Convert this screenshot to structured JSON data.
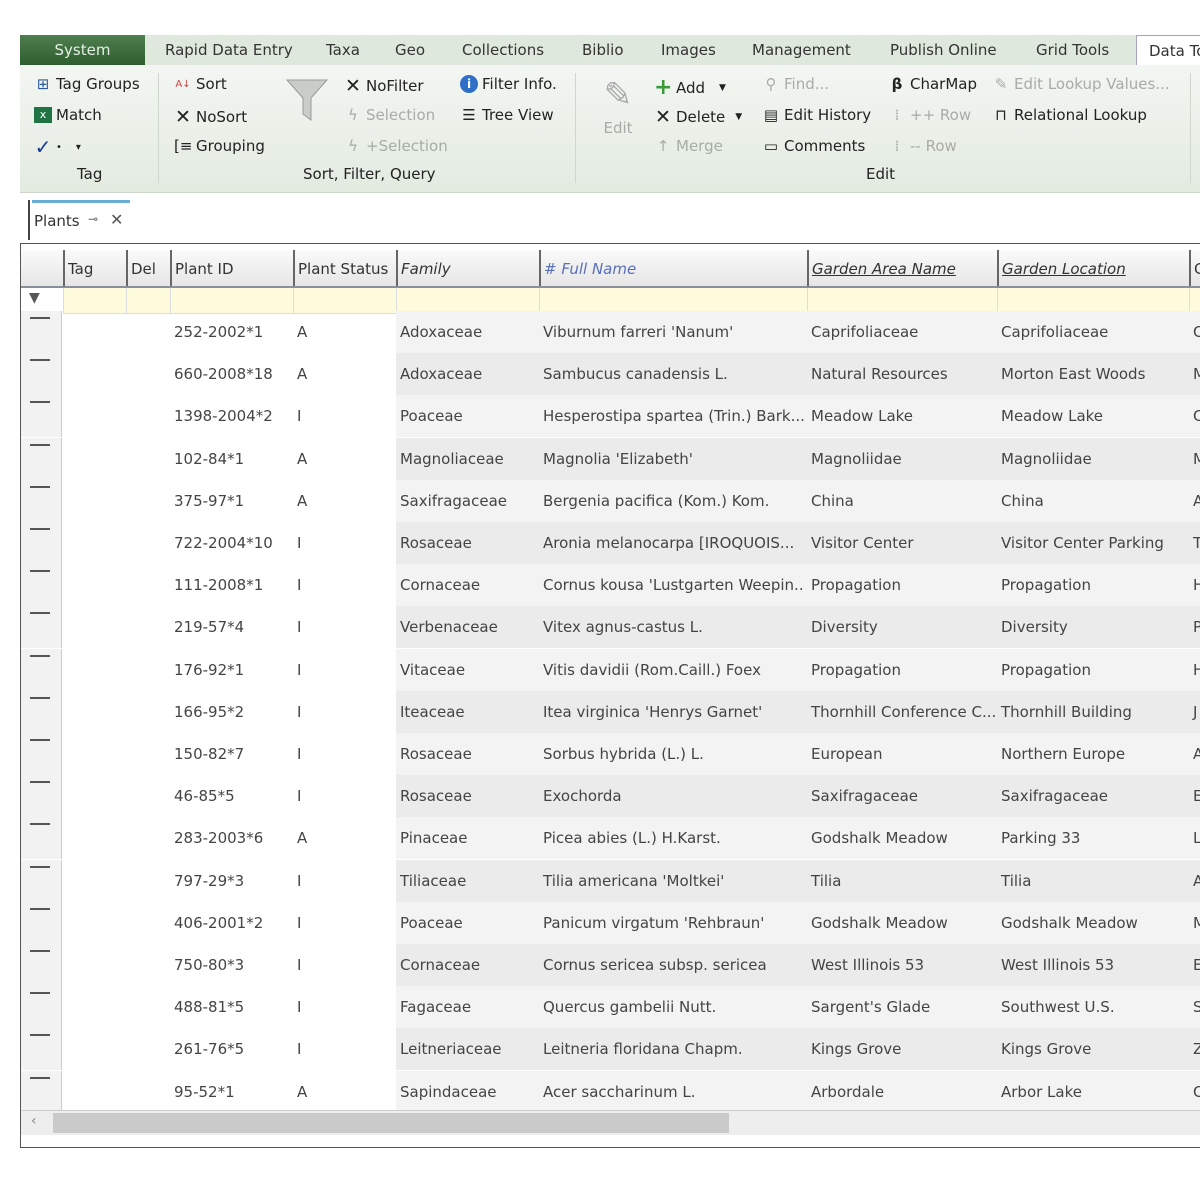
{
  "tabs": [
    "System",
    "Rapid Data Entry",
    "Taxa",
    "Geo",
    "Collections",
    "Biblio",
    "Images",
    "Management",
    "Publish Online",
    "Grid Tools",
    "Data To"
  ],
  "ribbon": {
    "tag": {
      "tag_groups": "Tag Groups",
      "match": "Match",
      "check_dropdown": "▾",
      "group_label": "Tag"
    },
    "sort_filter": {
      "sort": "Sort",
      "nosort": "NoSort",
      "grouping": "Grouping",
      "nofilter": "NoFilter",
      "selection": "Selection",
      "plus_selection": "+Selection",
      "filter_info": "Filter Info.",
      "tree_view": "Tree View",
      "group_label": "Sort, Filter, Query"
    },
    "edit": {
      "edit": "Edit",
      "add": "Add",
      "delete": "Delete",
      "merge": "Merge",
      "find": "Find...",
      "edit_history": "Edit History",
      "comments": "Comments",
      "charmap": "CharMap",
      "add_row": "++ Row",
      "remove_row": "-- Row",
      "edit_lookup": "Edit Lookup Values...",
      "relational_lookup": "Relational Lookup",
      "group_label": "Edit"
    }
  },
  "doc_tab": {
    "label": "Plants"
  },
  "grid": {
    "columns": [
      "Tag",
      "Del",
      "Plant ID",
      "Plant Status",
      "Family",
      "# Full Name",
      "Garden Area Name",
      "Garden Location",
      "G"
    ],
    "rows": [
      [
        "252-2002*1",
        "A",
        "Adoxaceae",
        "Viburnum farreri 'Nanum'",
        "Caprifoliaceae",
        "Caprifoliaceae",
        "C"
      ],
      [
        "660-2008*18",
        "A",
        "Adoxaceae",
        "Sambucus canadensis L.",
        "Natural Resources",
        "Morton East Woods",
        "M"
      ],
      [
        "1398-2004*2",
        "I",
        "Poaceae",
        "Hesperostipa spartea (Trin.) Bark...",
        "Meadow Lake",
        "Meadow Lake",
        "C"
      ],
      [
        "102-84*1",
        "A",
        "Magnoliaceae",
        "Magnolia 'Elizabeth'",
        "Magnoliidae",
        "Magnoliidae",
        "M"
      ],
      [
        "375-97*1",
        "A",
        "Saxifragaceae",
        "Bergenia pacifica (Kom.) Kom.",
        "China",
        "China",
        "A"
      ],
      [
        "722-2004*10",
        "I",
        "Rosaceae",
        "Aronia melanocarpa [IROQUOIS...",
        "Visitor Center",
        "Visitor Center Parking",
        "T"
      ],
      [
        "111-2008*1",
        "I",
        "Cornaceae",
        "Cornus kousa 'Lustgarten Weepin...",
        "Propagation",
        "Propagation",
        "H"
      ],
      [
        "219-57*4",
        "I",
        "Verbenaceae",
        "Vitex agnus-castus L.",
        "Diversity",
        "Diversity",
        "P"
      ],
      [
        "176-92*1",
        "I",
        "Vitaceae",
        "Vitis davidii (Rom.Caill.) Foex",
        "Propagation",
        "Propagation",
        "H"
      ],
      [
        "166-95*2",
        "I",
        "Iteaceae",
        "Itea virginica 'Henrys Garnet'",
        "Thornhill Conference C...",
        "Thornhill Building",
        "J"
      ],
      [
        "150-82*7",
        "I",
        "Rosaceae",
        "Sorbus hybrida (L.) L.",
        "European",
        "Northern Europe",
        "A"
      ],
      [
        "46-85*5",
        "I",
        "Rosaceae",
        "Exochorda",
        "Saxifragaceae",
        "Saxifragaceae",
        "E"
      ],
      [
        "283-2003*6",
        "A",
        "Pinaceae",
        "Picea abies (L.) H.Karst.",
        "Godshalk Meadow",
        "Parking 33",
        "L"
      ],
      [
        "797-29*3",
        "I",
        "Tiliaceae",
        "Tilia americana 'Moltkei'",
        "Tilia",
        "Tilia",
        "A"
      ],
      [
        "406-2001*2",
        "I",
        "Poaceae",
        "Panicum virgatum 'Rehbraun'",
        "Godshalk Meadow",
        "Godshalk Meadow",
        "M"
      ],
      [
        "750-80*3",
        "I",
        "Cornaceae",
        "Cornus sericea subsp. sericea",
        "West Illinois 53",
        "West Illinois 53",
        "E"
      ],
      [
        "488-81*5",
        "I",
        "Fagaceae",
        "Quercus gambelii Nutt.",
        "Sargent's Glade",
        "Southwest U.S.",
        "S"
      ],
      [
        "261-76*5",
        "I",
        "Leitneriaceae",
        "Leitneria floridana Chapm.",
        "Kings Grove",
        "Kings Grove",
        "Z"
      ],
      [
        "95-52*1",
        "A",
        "Sapindaceae",
        "Acer saccharinum L.",
        "Arbordale",
        "Arbor Lake",
        "C"
      ]
    ]
  },
  "colors": {
    "system_tab": "#3f6f3f",
    "filter_row": "#fdfbdc",
    "accent_blue": "#5a70b8"
  }
}
